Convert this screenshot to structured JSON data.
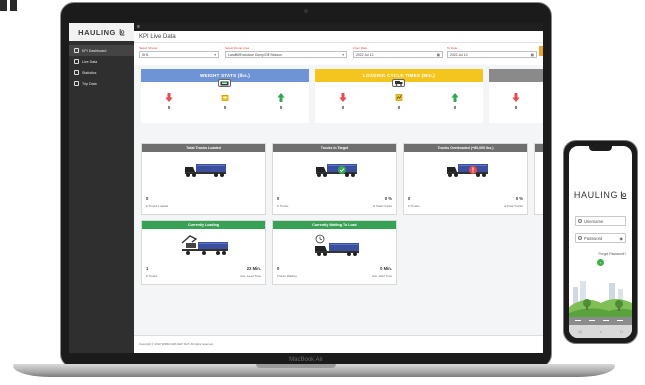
{
  "app": {
    "brand": "HAULING",
    "menu_glyph": "≡"
  },
  "sidebar": {
    "items": [
      {
        "label": "KPI Dashboard",
        "icon": "dashboard-icon"
      },
      {
        "label": "Live Data",
        "icon": "document-icon"
      },
      {
        "label": "Statistics",
        "icon": "chart-icon"
      },
      {
        "label": "Trip Data",
        "icon": "list-icon"
      }
    ]
  },
  "main": {
    "title": "KPI Live Data",
    "filters": [
      {
        "label": "Select Shovel",
        "value": "SH1"
      },
      {
        "label": "Select Dump Area",
        "value": "Landfill/Exclusive Dump/Off Season"
      },
      {
        "label": "From Date",
        "value": "2022 Jul 12"
      },
      {
        "label": "To Date",
        "value": "2022 Jul 13"
      }
    ],
    "weight_stats": {
      "title": "WEIGHT STATS (lbs.)",
      "badge_icon": "scale-icon",
      "values": [
        "0",
        "0",
        "0"
      ],
      "color": "#6f94d6"
    },
    "loading_cycle": {
      "title": "LOADING CYCLE TIMES (Min.)",
      "badge_icon": "dump-truck-icon",
      "values": [
        "0",
        "0",
        "0"
      ],
      "color": "#f4c51f"
    },
    "third_panel": {
      "values": [
        "0"
      ],
      "color": "#8a8a8a"
    },
    "total_trucks": {
      "title": "Total Trucks Loaded",
      "value": "0",
      "sub": "# Trucks Loaded"
    },
    "trucks_target": {
      "title": "Trucks In Target",
      "value": "0",
      "pct": "0 %",
      "sub": "# Trucks",
      "sub_right": "of Total Trucks"
    },
    "trucks_overloaded": {
      "title": "Trucks Overloaded (+80,000 lbs.)",
      "value": "0",
      "pct": "0 %",
      "sub": "# Trucks",
      "sub_right": "of Total Trucks"
    },
    "currently_loading": {
      "title": "Currently Loading",
      "value": "1",
      "time": "22 Min.",
      "sub": "# Trucks",
      "sub_right": "Ave. Load Time"
    },
    "currently_waiting": {
      "title": "Currently Waiting To Load",
      "value": "0",
      "time": "0 Min.",
      "sub": "Trucks Waiting",
      "sub_right": "Ave. Wait Time"
    },
    "footer": "Copyright © 2022 WSBA CMA SEV SGT. All rights reserved."
  },
  "device": {
    "model": "MacBook Air"
  },
  "phone": {
    "brand": "HAULING",
    "username_placeholder": "Username",
    "password_placeholder": "Password",
    "forgot": "Forgot Password?",
    "go_glyph": "›"
  },
  "colors": {
    "red_arrow": "#e84b4b",
    "green_arrow": "#36a852",
    "truck_blue": "#3b4f9e"
  }
}
